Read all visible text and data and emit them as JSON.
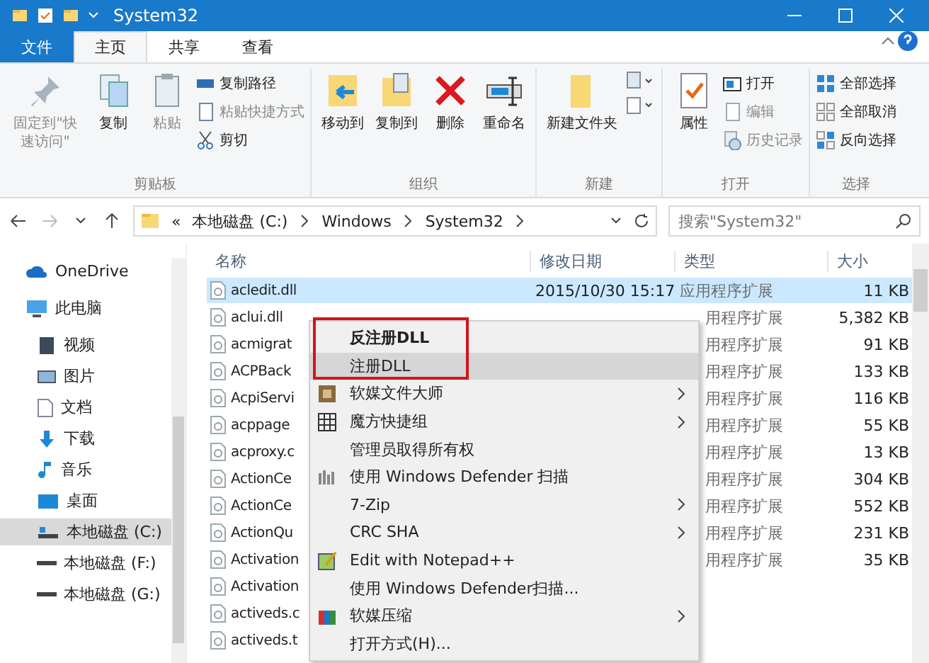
{
  "window": {
    "title": "System32"
  },
  "tabs": [
    {
      "label": "文件",
      "kind": "file",
      "selected": false
    },
    {
      "label": "主页",
      "kind": "tab",
      "selected": true
    },
    {
      "label": "共享",
      "kind": "tab",
      "selected": false
    },
    {
      "label": "查看",
      "kind": "tab",
      "selected": false
    }
  ],
  "ribbon": {
    "groups": [
      {
        "label": "剪贴板",
        "large": [
          {
            "label": "固定到\"快速访问\"",
            "disabled": true
          },
          {
            "label": "复制",
            "disabled": false
          },
          {
            "label": "粘贴",
            "disabled": true
          }
        ],
        "small": [
          {
            "label": "复制路径",
            "disabled": false
          },
          {
            "label": "粘贴快捷方式",
            "disabled": true
          },
          {
            "label": "剪切",
            "disabled": false
          }
        ]
      },
      {
        "label": "组织",
        "large": [
          {
            "label": "移动到",
            "disabled": false
          },
          {
            "label": "复制到",
            "disabled": false
          },
          {
            "label": "删除",
            "disabled": false
          },
          {
            "label": "重命名",
            "disabled": false
          }
        ]
      },
      {
        "label": "新建",
        "large": [
          {
            "label": "新建文件夹",
            "disabled": false
          }
        ]
      },
      {
        "label": "打开",
        "large": [
          {
            "label": "属性",
            "disabled": false
          }
        ],
        "small": [
          {
            "label": "打开",
            "disabled": false
          },
          {
            "label": "编辑",
            "disabled": true
          },
          {
            "label": "历史记录",
            "disabled": true
          }
        ]
      },
      {
        "label": "选择",
        "small": [
          {
            "label": "全部选择",
            "disabled": false
          },
          {
            "label": "全部取消",
            "disabled": false
          },
          {
            "label": "反向选择",
            "disabled": false
          }
        ]
      }
    ]
  },
  "address": {
    "overflow": "«",
    "path": [
      "本地磁盘 (C:)",
      "Windows",
      "System32"
    ]
  },
  "search": {
    "placeholder": "搜索\"System32\""
  },
  "sidebar": {
    "items": [
      {
        "label": "OneDrive",
        "selected": false
      },
      {
        "label": "此电脑",
        "selected": false
      },
      {
        "label": "视频",
        "selected": false
      },
      {
        "label": "图片",
        "selected": false
      },
      {
        "label": "文档",
        "selected": false
      },
      {
        "label": "下载",
        "selected": false
      },
      {
        "label": "音乐",
        "selected": false
      },
      {
        "label": "桌面",
        "selected": false
      },
      {
        "label": "本地磁盘 (C:)",
        "selected": true
      },
      {
        "label": "本地磁盘 (F:)",
        "selected": false
      },
      {
        "label": "本地磁盘 (G:)",
        "selected": false
      }
    ]
  },
  "table": {
    "columns": [
      "名称",
      "修改日期",
      "类型",
      "大小"
    ],
    "rows": [
      {
        "name": "acledit.dll",
        "date": "2015/10/30 15:17",
        "type": "应用程序扩展",
        "size": "11 KB",
        "selected": true
      },
      {
        "name": "aclui.dll",
        "type": "用程序扩展",
        "size": "5,382 KB",
        "selected": false
      },
      {
        "name": "acmigrat",
        "type": "用程序扩展",
        "size": "91 KB",
        "selected": false
      },
      {
        "name": "ACPBack",
        "type": "用程序扩展",
        "size": "133 KB",
        "selected": false
      },
      {
        "name": "AcpiServi",
        "type": "用程序扩展",
        "size": "116 KB",
        "selected": false
      },
      {
        "name": "acppage",
        "type": "用程序扩展",
        "size": "55 KB",
        "selected": false
      },
      {
        "name": "acproxy.c",
        "type": "用程序扩展",
        "size": "13 KB",
        "selected": false
      },
      {
        "name": "ActionCe",
        "type": "用程序扩展",
        "size": "304 KB",
        "selected": false
      },
      {
        "name": "ActionCe",
        "type": "用程序扩展",
        "size": "552 KB",
        "selected": false
      },
      {
        "name": "ActionQu",
        "type": "用程序扩展",
        "size": "231 KB",
        "selected": false
      },
      {
        "name": "Activation",
        "type": "用程序扩展",
        "size": "35 KB",
        "selected": false
      },
      {
        "name": "Activation",
        "selected": false
      },
      {
        "name": "activeds.c",
        "selected": false
      },
      {
        "name": "activeds.t",
        "selected": false
      }
    ]
  },
  "context_menu": {
    "items": [
      {
        "label": "反注册DLL",
        "bold": true,
        "selected": false,
        "has_icon": false,
        "submenu": false
      },
      {
        "label": "注册DLL",
        "bold": false,
        "selected": true,
        "has_icon": false,
        "submenu": false
      },
      {
        "label": "软媒文件大师",
        "bold": false,
        "selected": false,
        "has_icon": true,
        "submenu": true
      },
      {
        "label": "魔方快捷组",
        "bold": false,
        "selected": false,
        "has_icon": true,
        "submenu": true
      },
      {
        "label": "管理员取得所有权",
        "bold": false,
        "selected": false,
        "has_icon": false,
        "submenu": false
      },
      {
        "label": "使用 Windows Defender 扫描",
        "bold": false,
        "selected": false,
        "has_icon": true,
        "submenu": false
      },
      {
        "label": "7-Zip",
        "bold": false,
        "selected": false,
        "has_icon": false,
        "submenu": true
      },
      {
        "label": "CRC SHA",
        "bold": false,
        "selected": false,
        "has_icon": false,
        "submenu": true
      },
      {
        "label": "Edit with Notepad++",
        "bold": false,
        "selected": false,
        "has_icon": true,
        "submenu": false
      },
      {
        "label": "使用 Windows Defender扫描...",
        "bold": false,
        "selected": false,
        "has_icon": false,
        "submenu": false
      },
      {
        "label": "软媒压缩",
        "bold": false,
        "selected": false,
        "has_icon": true,
        "submenu": true
      },
      {
        "label": "打开方式(H)...",
        "bold": false,
        "selected": false,
        "has_icon": false,
        "submenu": false
      }
    ]
  }
}
